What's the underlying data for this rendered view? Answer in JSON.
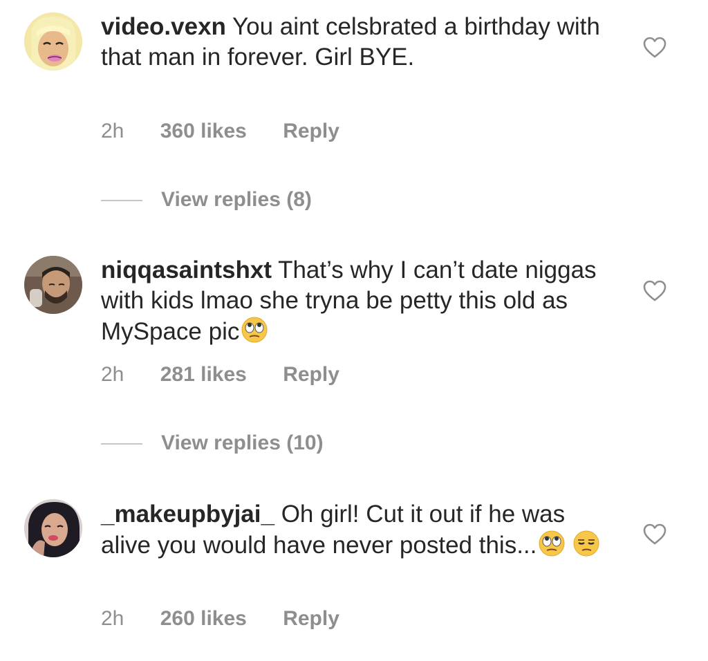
{
  "comments": [
    {
      "username": "video.vexn",
      "text": "You aint celsbrated a birthday with that man in forever. Girl BYE.",
      "time": "2h",
      "likes": "360 likes",
      "reply": "Reply",
      "view_replies": "View replies (8)",
      "avatar_icon": "cartoon-blonde-avatar",
      "emojis": []
    },
    {
      "username": "niqqasaintshxt",
      "text": "That’s why I can’t date niggas with kids lmao she tryna be petty this old as MySpace pic",
      "time": "2h",
      "likes": "281 likes",
      "reply": "Reply",
      "view_replies": "View replies (10)",
      "avatar_icon": "man-photo-avatar",
      "emojis": [
        "face-with-rolling-eyes-emoji"
      ]
    },
    {
      "username": "_makeupbyjai_",
      "text": "Oh girl! Cut it out if he was alive you would have never posted this...",
      "time": "2h",
      "likes": "260 likes",
      "reply": "Reply",
      "avatar_icon": "woman-photo-avatar",
      "emojis": [
        "face-with-rolling-eyes-emoji",
        "unamused-face-emoji"
      ]
    }
  ],
  "colors": {
    "text": "#262626",
    "meta": "#8e8e8e",
    "divider": "#c7c7c7",
    "background": "#ffffff"
  },
  "icons": {
    "like": "heart-outline-icon"
  }
}
